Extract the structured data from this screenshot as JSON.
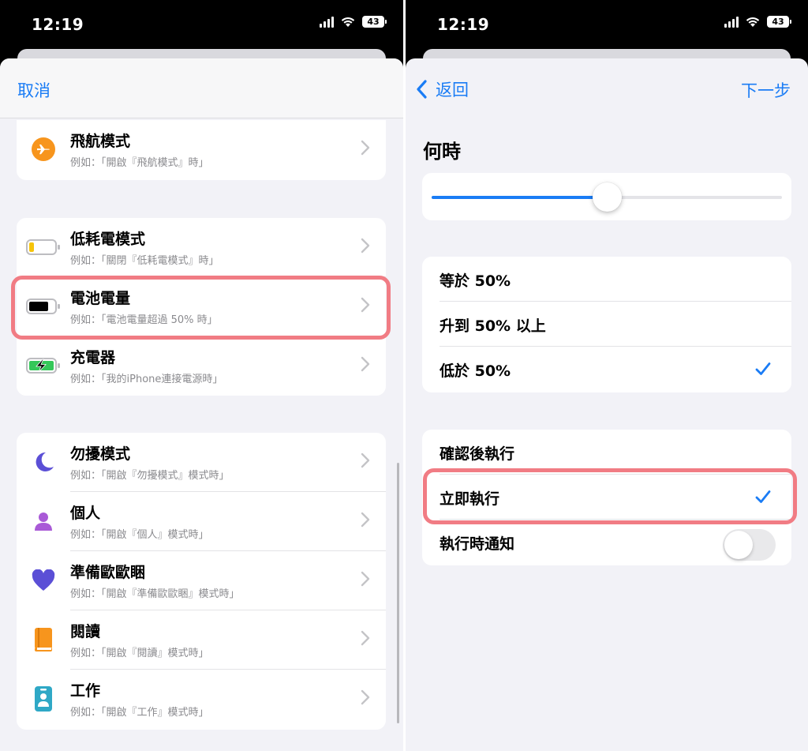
{
  "status": {
    "time": "12:19",
    "battery": "43"
  },
  "left": {
    "nav": {
      "cancel": "取消"
    },
    "group1": [
      {
        "title": "飛航模式",
        "sub": "例如：「開啟『飛航模式』時」",
        "icon": "airplane-icon",
        "color": "#f7951d"
      }
    ],
    "group2": [
      {
        "title": "低耗電模式",
        "sub": "例如：「關閉『低耗電模式』時」",
        "icon": "low-battery-icon"
      },
      {
        "title": "電池電量",
        "sub": "例如：「電池電量超過 50% 時」",
        "icon": "battery-level-icon"
      },
      {
        "title": "充電器",
        "sub": "例如：「我的iPhone連接電源時」",
        "icon": "charging-battery-icon"
      }
    ],
    "group3": [
      {
        "title": "勿擾模式",
        "sub": "例如：「開啟『勿擾模式』模式時」",
        "icon": "moon-icon",
        "color": "#5b4fd6"
      },
      {
        "title": "個人",
        "sub": "例如：「開啟『個人』模式時」",
        "icon": "person-icon",
        "color": "#a95ad7"
      },
      {
        "title": "準備歐歐睏",
        "sub": "例如：「開啟『準備歐歐睏』模式時」",
        "icon": "heart-icon",
        "color": "#5b4fd6"
      },
      {
        "title": "閱讀",
        "sub": "例如：「開啟『閱讀』模式時」",
        "icon": "book-icon",
        "color": "#f7951d"
      },
      {
        "title": "工作",
        "sub": "例如：「開啟『工作』模式時」",
        "icon": "id-badge-icon",
        "color": "#2fa8c6"
      }
    ]
  },
  "right": {
    "nav": {
      "back": "返回",
      "next": "下一步"
    },
    "section_title": "何時",
    "slider": {
      "value_fraction": 0.5
    },
    "conditions": [
      {
        "label": "等於 50%",
        "checked": false
      },
      {
        "label": "升到 50% 以上",
        "checked": false
      },
      {
        "label": "低於 50%",
        "checked": true
      }
    ],
    "run_options": [
      {
        "label": "確認後執行",
        "checked": false
      },
      {
        "label": "立即執行",
        "checked": true
      }
    ],
    "notify": {
      "label": "執行時通知",
      "on": false
    }
  },
  "colors": {
    "accent": "#1a7cf5",
    "highlight": "#f17c84",
    "background": "#f2f2f7"
  }
}
